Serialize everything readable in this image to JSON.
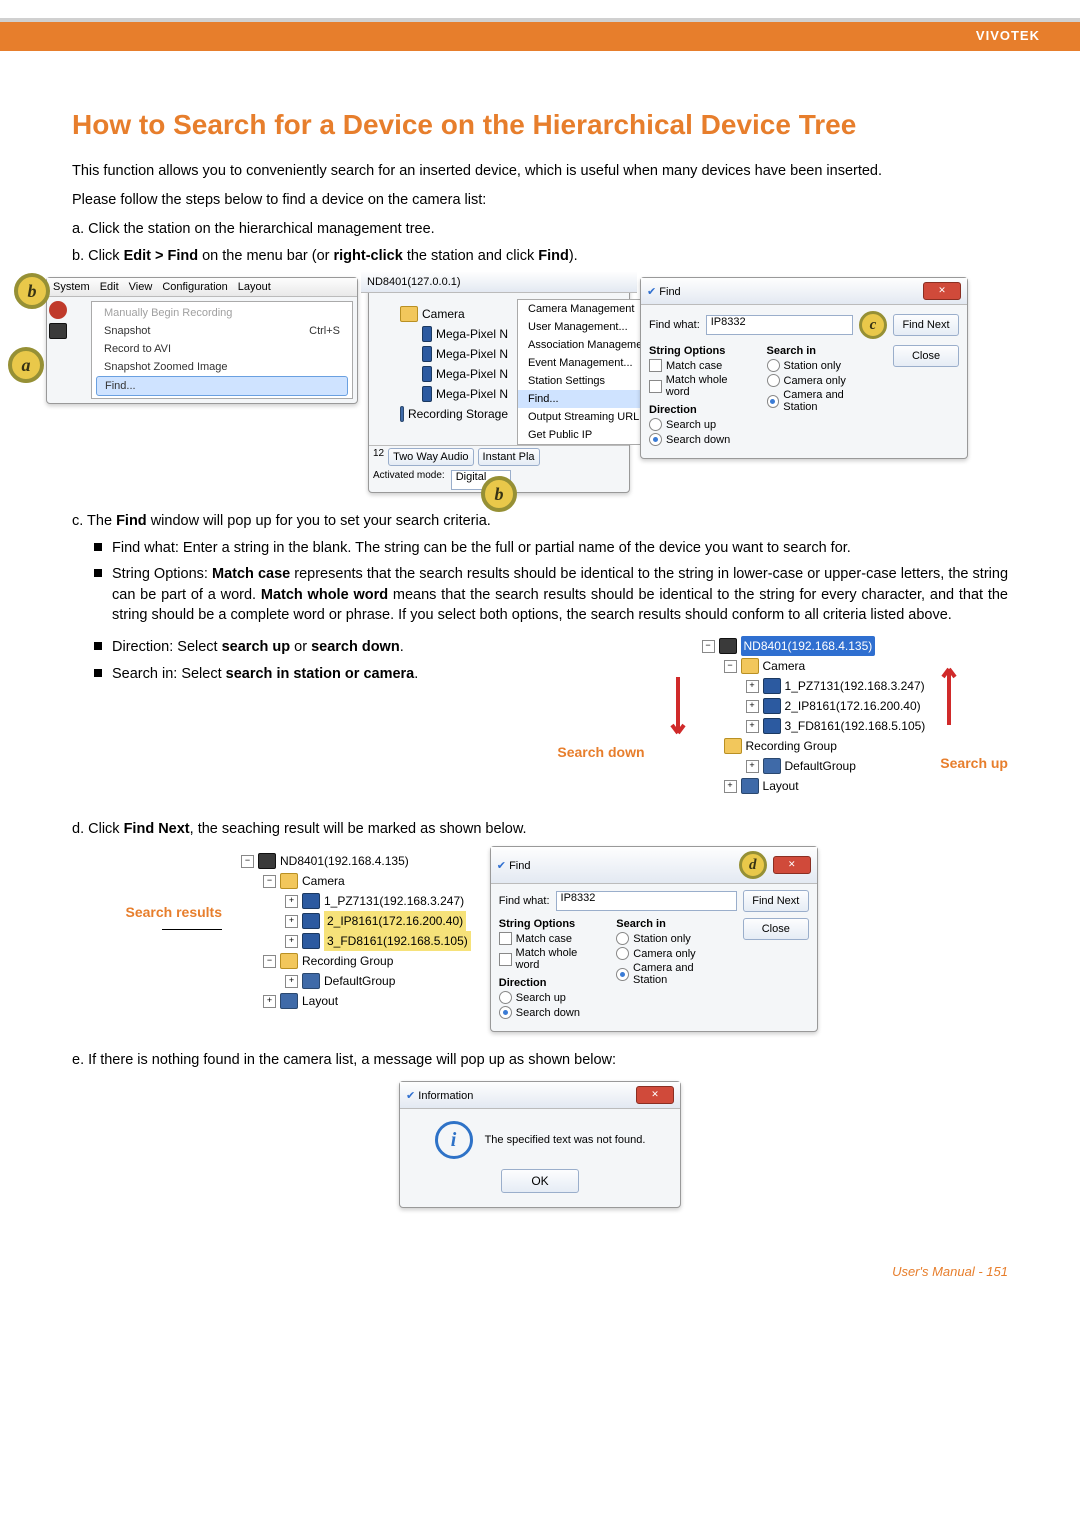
{
  "brand": "VIVOTEK",
  "title": "How to Search for a Device on the Hierarchical Device Tree",
  "intro": "This function allows you to conveniently search for an inserted device, which is useful when many devices have been inserted.",
  "follow": "Please follow the steps below to find a device on the camera list:",
  "steps": {
    "a": {
      "pre": "a. Click the station on the hierarchical management tree."
    },
    "b": {
      "pre": "b. Click ",
      "b1": "Edit > Find",
      "mid": " on the menu bar (or ",
      "b2": "right-click",
      "mid2": " the station and click ",
      "b3": "Find",
      "post": ")."
    },
    "c": {
      "pre": "c. The ",
      "b1": "Find",
      "post": " window will pop up for you to set your search criteria."
    },
    "d": {
      "pre": "d. Click ",
      "b1": "Find Next",
      "post": ", the seaching result will be marked as shown below."
    },
    "e": "e. If there is nothing found in the camera list, a message will pop up as shown below:"
  },
  "c_bullets": {
    "fw": "Find what: Enter a string in the blank. The string can be the full or partial name of the device you want to search for.",
    "so": {
      "pre": "String Options: ",
      "b1": "Match case",
      "m1": " represents that the search results should be identical to the string in lower-case or upper-case letters, the string can be part of a word. ",
      "b2": "Match whole word",
      "m2": " means that the search results should be identical to the string for every character, and that the string should be a complete word or phrase. If you select both options, the search results should conform to all criteria listed above."
    },
    "dir": {
      "pre": "Direction: Select ",
      "b1": "search up",
      "mid": " or ",
      "b2": "search down",
      "post": "."
    },
    "si": {
      "pre": "Search in: Select ",
      "b1": "search in station or camera",
      "post": "."
    }
  },
  "labels": {
    "search_down": "Search down",
    "search_up": "Search up",
    "search_results": "Search results"
  },
  "badges": {
    "a": "a",
    "b": "b",
    "c": "c",
    "d": "d"
  },
  "panel_a": {
    "menubar": [
      "System",
      "Edit",
      "View",
      "Configuration",
      "Layout"
    ],
    "items": [
      {
        "label": "Manually Begin Recording",
        "disabled": true
      },
      {
        "label": "Snapshot",
        "shortcut": "Ctrl+S"
      },
      {
        "label": "Record to AVI"
      },
      {
        "label": "Snapshot Zoomed Image"
      },
      {
        "label": "Find...",
        "hl": true
      }
    ]
  },
  "panel_b": {
    "left_tree": [
      "Camera",
      "Mega-Pixel N",
      "Mega-Pixel N",
      "Mega-Pixel N",
      "Mega-Pixel N",
      "Recording Storage"
    ],
    "footer1": "Two Way Audio",
    "footer2": "Instant Pla",
    "footer3": "Activated mode:",
    "footer4": "Digital",
    "ctx": [
      "Camera Management",
      "User Management...",
      "Association Management...",
      "Event Management...",
      "Station Settings",
      "Find...",
      "Output Streaming URL",
      "Get Public IP"
    ]
  },
  "find_dialog": {
    "title": "Find",
    "find_what_label": "Find what:",
    "find_what_value": "IP8332",
    "find_next": "Find Next",
    "close": "Close",
    "string_opts_hd": "String Options",
    "match_case": "Match case",
    "match_whole": "Match whole word",
    "search_in_hd": "Search in",
    "station_only": "Station only",
    "camera_only": "Camera only",
    "camera_station": "Camera and Station",
    "direction_hd": "Direction",
    "search_up": "Search up",
    "search_down": "Search down"
  },
  "tree1": {
    "root": "ND8401(192.168.4.135)",
    "camera": "Camera",
    "c1": "1_PZ7131(192.168.3.247)",
    "c2": "2_IP8161(172.16.200.40)",
    "c3": "3_FD8161(192.168.5.105)",
    "recgrp": "Recording Group",
    "defgrp": "DefaultGroup",
    "layout": "Layout"
  },
  "info": {
    "title": "Information",
    "msg": "The specified text was not found.",
    "ok": "OK"
  },
  "footer": {
    "label": "User's Manual - ",
    "page": "151"
  }
}
